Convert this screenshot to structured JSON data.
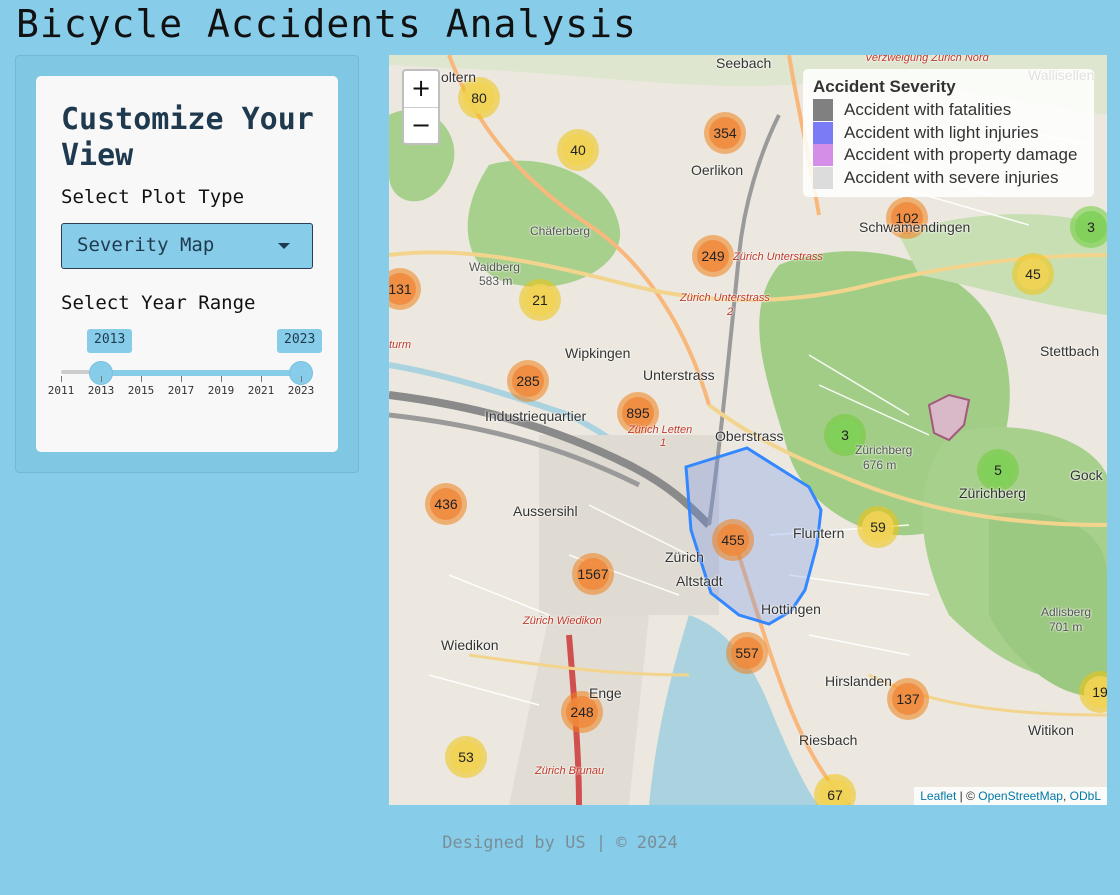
{
  "app": {
    "title": "Bicycle Accidents Analysis"
  },
  "sidebar": {
    "heading": "Customize Your View",
    "plot_type_label": "Select Plot Type",
    "plot_type_value": "Severity Map",
    "year_range_label": "Select Year Range",
    "year_range": {
      "from": "2013",
      "to": "2023",
      "min": 2011,
      "max": 2023,
      "from_value": 2013,
      "to_value": 2023
    },
    "ticks": [
      "2011",
      "2013",
      "2015",
      "2017",
      "2019",
      "2021",
      "2023"
    ]
  },
  "map": {
    "zoom_in": "+",
    "zoom_out": "−",
    "legend": {
      "title": "Accident Severity",
      "items": [
        {
          "label": "Accident with fatalities",
          "color": "#808080"
        },
        {
          "label": "Accident with light injuries",
          "color": "#7b7bf5"
        },
        {
          "label": "Accident with property damage",
          "color": "#d48ee8"
        },
        {
          "label": "Accident with severe injuries",
          "color": "#dcdcdc"
        }
      ]
    },
    "clusters": [
      {
        "count": "80",
        "level": "yellow"
      },
      {
        "count": "40",
        "level": "yellow"
      },
      {
        "count": "354",
        "level": "orange"
      },
      {
        "count": "102",
        "level": "orange"
      },
      {
        "count": "3",
        "level": "green"
      },
      {
        "count": "249",
        "level": "orange"
      },
      {
        "count": "45",
        "level": "yellow"
      },
      {
        "count": "131",
        "level": "orange"
      },
      {
        "count": "21",
        "level": "yellow"
      },
      {
        "count": "285",
        "level": "orange"
      },
      {
        "count": "895",
        "level": "orange"
      },
      {
        "count": "3",
        "level": "green"
      },
      {
        "count": "5",
        "level": "green"
      },
      {
        "count": "436",
        "level": "orange"
      },
      {
        "count": "455",
        "level": "orange"
      },
      {
        "count": "59",
        "level": "yellow"
      },
      {
        "count": "1567",
        "level": "orange"
      },
      {
        "count": "557",
        "level": "orange"
      },
      {
        "count": "137",
        "level": "orange"
      },
      {
        "count": "248",
        "level": "orange"
      },
      {
        "count": "53",
        "level": "yellow"
      },
      {
        "count": "67",
        "level": "yellow"
      },
      {
        "count": "19",
        "level": "yellow"
      }
    ],
    "places": {
      "seebach": "Seebach",
      "oerlikon": "Oerlikon",
      "schwamendingen": "Schwamendingen",
      "wipkingen": "Wipkingen",
      "unterstrass": "Unterstrass",
      "industriequartier": "Industriequartier",
      "oberstrass": "Oberstrass",
      "aussersihl": "Aussersihl",
      "zurich": "Zürich",
      "altstadt": "Altstadt",
      "fluntern": "Fluntern",
      "hottingen": "Hottingen",
      "wiedikon": "Wiedikon",
      "enge": "Enge",
      "hirslanden": "Hirslanden",
      "riesbach": "Riesbach",
      "witikon": "Witikon",
      "stettbach": "Stettbach",
      "zurichberg": "Zürichberg",
      "gockhausen": "Gock",
      "wallisellen": "Wallisellen",
      "oltern": "oltern",
      "waidberg": "Waidberg",
      "waidberg_h": "583 m",
      "chaferberg": "Chäferberg",
      "zurichberg_peak": "Zürichberg",
      "zurichberg_h": "676 m",
      "adlisberg": "Adlisberg",
      "adlisberg_h": "701 m",
      "st_unterstrass_1": "Zürich Unterstrass",
      "st_unterstrass_2": "Zürich Unterstrass",
      "st_two": "2",
      "st_letten": "Zürich Letten",
      "st_one": "1",
      "st_wiedikon": "Zürich Wiedikon",
      "st_brunau": "Zürich Brunau",
      "st_nord": "Verzweigung Zürich Nord",
      "turm": "turm"
    },
    "attribution": {
      "leaflet": "Leaflet",
      "sep": " | © ",
      "osm": "OpenStreetMap",
      "comma": ", ",
      "odbl": "ODbL"
    }
  },
  "footer": {
    "text": "Designed by US | © 2024"
  }
}
